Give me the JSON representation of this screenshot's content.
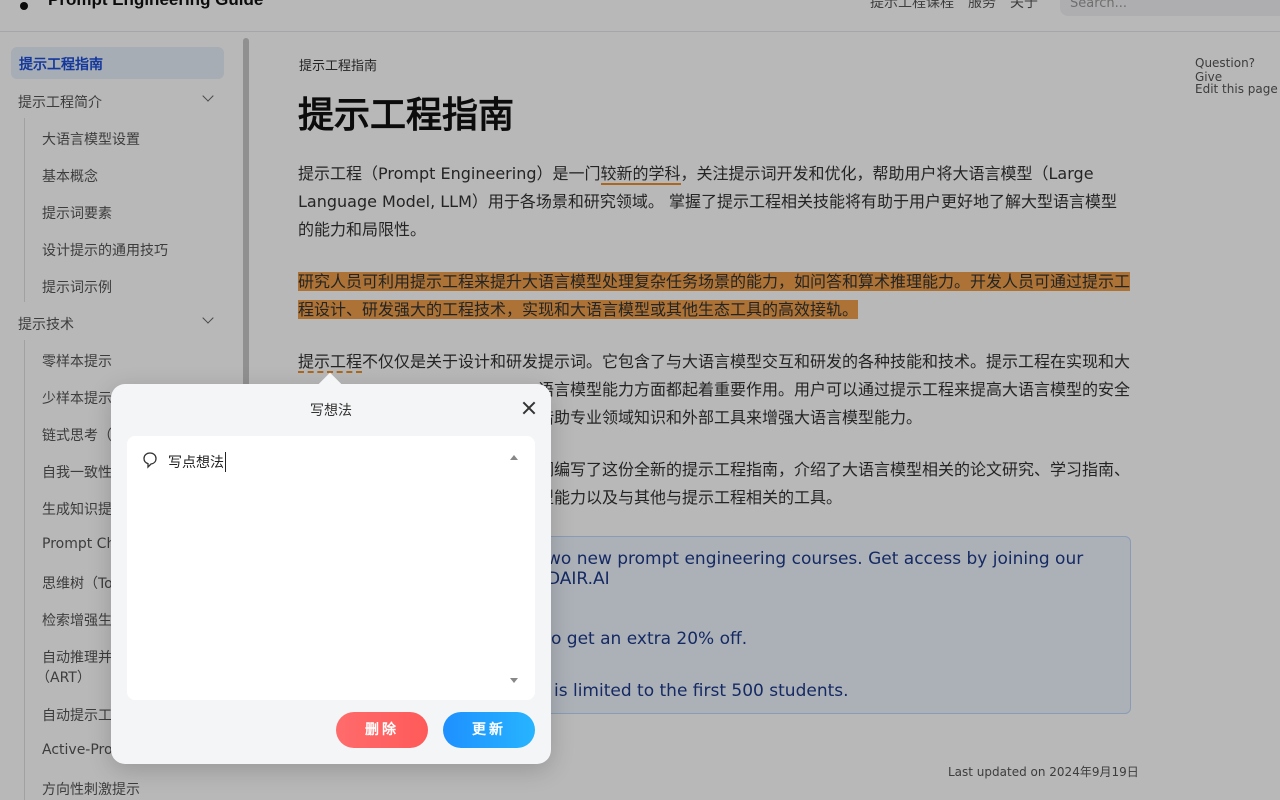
{
  "header": {
    "logo_text": "Prompt Engineering Guide",
    "nav": [
      "提示工程课程",
      "服务",
      "关于"
    ],
    "search_placeholder": "Search..."
  },
  "sidebar": {
    "active": "提示工程指南",
    "sections": [
      {
        "label": "提示工程简介",
        "children": [
          "大语言模型设置",
          "基本概念",
          "提示词要素",
          "设计提示的通用技巧",
          "提示词示例"
        ]
      },
      {
        "label": "提示技术",
        "children": [
          "零样本提示",
          "少样本提示",
          "链式思考（",
          "自我一致性",
          "生成知识提",
          "Prompt Ch",
          "思维树（To",
          "检索增强生",
          "自动推理并",
          "（ART）",
          "自动提示工",
          "Active-Pro",
          "方向性刺激提示"
        ]
      }
    ]
  },
  "main": {
    "breadcrumb": "提示工程指南",
    "title": "提示工程指南",
    "p1_a": "提示工程（Prompt Engineering）是一门",
    "p1_u": "较新的学科",
    "p1_b": "，关注提示词开发和优化，帮助用户将大语言模型（Large Language Model, LLM）用于各场景和研究领域。 掌握了提示工程相关技能将有助于用户更好地了解大型语言模型的能力和局限性。",
    "p2": "研究人员可利用提示工程来提升大语言模型处理复杂任务场景的能力，如问答和算术推理能力。开发人员可通过提示工程设计、研发强大的工程技术，实现和大语言模型或其他生态工具的高效接轨。",
    "p3_u": "提示工程",
    "p3_a": "不仅仅是关于设计和研发提示词。它包含了与大语言模型交互和研发的各种技能和技术。提示工程在实现和大",
    "p3_line2": "语言模型能力方面都起着重要作用。用户可以通过提示工程来提高大语言模型的安全",
    "p3_line3": "借助专业领域知识和外部工具来增强大语言模型能力。",
    "p4_line1": "们编写了这份全新的提示工程指南，介绍了大语言模型相关的论文研究、学习指南、",
    "p4_line2": "型能力以及与其他与提示工程相关的工具。",
    "callout": [
      "wo new prompt engineering courses. Get access by joining our DAIR.AI",
      "o get an extra 20% off.",
      "is limited to the first 500 students."
    ],
    "updated": "Last updated on 2024年9月19日"
  },
  "right_rail": {
    "question": "Question? Give",
    "edit": "Edit this page"
  },
  "dialog": {
    "title": "写想法",
    "text": "写点想法",
    "delete_label": "删除",
    "update_label": "更新"
  }
}
